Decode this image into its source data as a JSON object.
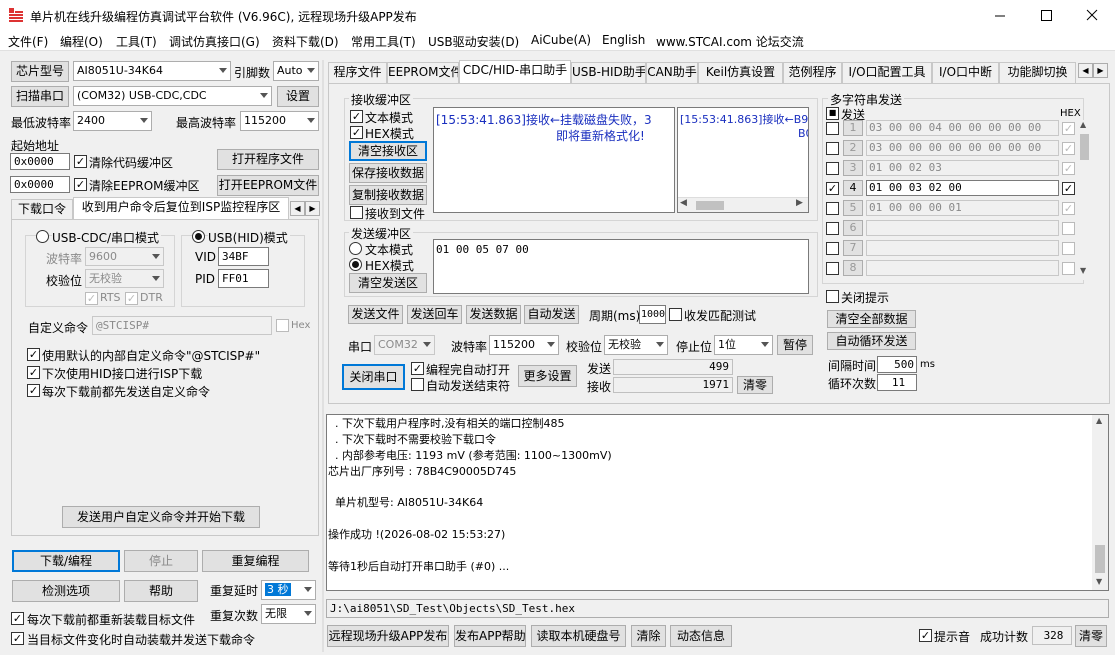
{
  "window": {
    "title": "单片机在线升级编程仿真调试平台软件 (V6.96C), 远程现场升级APP发布",
    "min_icon": "minimize-icon",
    "max_icon": "maximize-icon",
    "close_icon": "close-icon"
  },
  "menu": [
    "文件(F)",
    "编程(O)",
    "工具(T)",
    "调试仿真接口(G)",
    "资料下载(D)",
    "常用工具(T)",
    "USB驱动安装(D)",
    "AiCube(A)",
    "English",
    "www.STCAI.com 论坛交流"
  ],
  "left": {
    "chip_type_btn": "芯片型号",
    "chip_type": "AI8051U-34K64",
    "pin_label": "引脚数",
    "pin_value": "Auto",
    "scan_btn": "扫描串口",
    "port": "(COM32) USB-CDC,CDC",
    "settings_btn": "设置",
    "min_baud_label": "最低波特率",
    "min_baud": "2400",
    "max_baud_label": "最高波特率",
    "max_baud": "115200",
    "start_addr_label": "起始地址",
    "addr1": "0x0000",
    "clear_code": "清除代码缓冲区",
    "open_prog_btn": "打开程序文件",
    "addr2": "0x0000",
    "clear_eeprom": "清除EEPROM缓冲区",
    "open_eeprom_btn": "打开EEPROM文件",
    "tabs": [
      "下载口令",
      "收到用户命令后复位到ISP监控程序区"
    ],
    "usb_cdc_mode": "USB-CDC/串口模式",
    "usb_hid_mode": "USB(HID)模式",
    "baud_label": "波特率",
    "baud_value": "9600",
    "parity_label": "校验位",
    "parity_value": "无校验",
    "rts": "RTS",
    "dtr": "DTR",
    "vid_label": "VID",
    "vid": "34BF",
    "pid_label": "PID",
    "pid": "FF01",
    "custom_cmd_label": "自定义命令",
    "custom_cmd": "@STCISP#",
    "hex_label": "Hex",
    "opt1": "使用默认的内部自定义命令\"@STCISP#\"",
    "opt2": "下次使用HID接口进行ISP下载",
    "opt3": "每次下载前都先发送自定义命令",
    "send_custom_btn": "发送用户自定义命令并开始下载",
    "download_btn": "下载/编程",
    "stop_btn": "停止",
    "reprogram_btn": "重复编程",
    "check_btn": "检测选项",
    "help_btn": "帮助",
    "repeat_delay_label": "重复延时",
    "repeat_delay": "3 秒",
    "repeat_count_label": "重复次数",
    "repeat_count": "无限",
    "reload_each": "每次下载前都重新装载目标文件",
    "auto_reload": "当目标文件变化时自动装载并发送下载命令"
  },
  "tabs": [
    "程序文件",
    "EEPROM文件",
    "CDC/HID-串口助手",
    "USB-HID助手",
    "CAN助手",
    "Keil仿真设置",
    "范例程序",
    "I/O口配置工具",
    "I/O口中断",
    "功能脚切换"
  ],
  "serial": {
    "recv_group": "接收缓冲区",
    "text_mode": "文本模式",
    "hex_mode": "HEX模式",
    "clear_recv": "清空接收区",
    "save_recv": "保存接收数据",
    "copy_recv": "复制接收数据",
    "recv_to_file": "接收到文件",
    "recv_text_line1": "[15:53:41.863]接收←挂载磁盘失败，3",
    "recv_text_line2": "即将重新格式化!",
    "recv_hex_line1": "[15:53:41.863]接收←B9",
    "recv_hex_line2": "B0",
    "send_group": "发送缓冲区",
    "send_text_mode": "文本模式",
    "send_hex_mode": "HEX模式",
    "clear_send": "清空发送区",
    "send_data": "01 00 05 07 00",
    "send_file": "发送文件",
    "send_back": "发送回车",
    "send_btn": "发送数据",
    "auto_send": "自动发送",
    "period_label": "周期(ms)",
    "period": "1000",
    "match_test": "收发匹配测试",
    "port_label": "串口",
    "port": "COM32",
    "baud_label": "波特率",
    "baud": "115200",
    "parity_label": "校验位",
    "parity": "无校验",
    "stop_label": "停止位",
    "stop": "1位",
    "pause": "暂停",
    "close_port": "关闭串口",
    "auto_open": "编程完自动打开",
    "auto_send_end": "自动发送结束符",
    "more_settings": "更多设置",
    "send_label": "发送",
    "send_count": "499",
    "recv_label": "接收",
    "recv_count": "1971",
    "clear_count": "清零"
  },
  "multi": {
    "title": "多字符串发送",
    "send_header": "发送",
    "hex_header": "HEX",
    "rows": [
      {
        "n": "1",
        "data": "03 00 00 04 00 00 00 00 00"
      },
      {
        "n": "2",
        "data": "03 00 00 00 00 00 00 00 00"
      },
      {
        "n": "3",
        "data": "01 00 02 03"
      },
      {
        "n": "4",
        "data": "01 00 03 02 00"
      },
      {
        "n": "5",
        "data": "01 00 00 00 01"
      },
      {
        "n": "6",
        "data": ""
      },
      {
        "n": "7",
        "data": ""
      },
      {
        "n": "8",
        "data": ""
      }
    ],
    "close_prompt": "关闭提示",
    "clear_all": "清空全部数据",
    "auto_loop": "自动循环发送",
    "interval_label": "间隔时间",
    "interval": "500",
    "interval_unit": "ms",
    "loop_label": "循环次数",
    "loop": "11"
  },
  "log": [
    "  . 下次下载用户程序时,没有相关的端口控制485",
    "  . 下次下载时不需要校验下载口令",
    "  . 内部参考电压: 1193 mV (参考范围: 1100~1300mV)",
    "芯片出厂序列号 : 78B4C90005D745",
    "",
    "  单片机型号: AI8051U-34K64",
    "",
    "操作成功 !(2026-08-02 15:53:27)",
    "",
    "等待1秒后自动打开串口助手 (#0) ..."
  ],
  "filepath": "J:\\ai8051\\SD_Test\\Objects\\SD_Test.hex",
  "bottom": {
    "publish_btn": "远程现场升级APP发布",
    "publish_help": "发布APP帮助",
    "read_disk": "读取本机硬盘号",
    "clear_btn": "清除",
    "news_btn": "动态信息",
    "sound": "提示音",
    "success_label": "成功计数",
    "success_count": "328",
    "clear_zero": "清零"
  }
}
